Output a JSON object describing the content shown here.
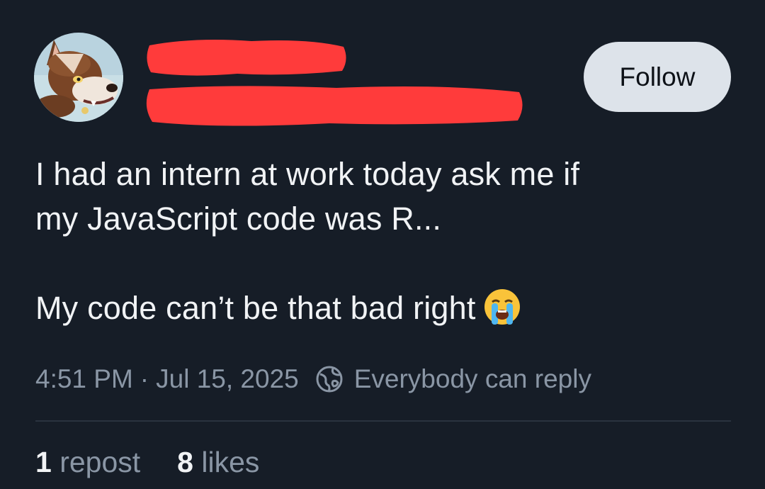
{
  "post": {
    "author_avatar_icon": "avatar-wolf-fursona",
    "redaction_color": "#ff3b3b",
    "follow_label": "Follow",
    "text_lines": [
      "I had an intern at work today ask me if",
      "my JavaScript code was R...",
      "My code can’t be that bad right"
    ],
    "emoji": "😭",
    "emoji_icon": "loudly-crying-face-icon",
    "timestamp": "4:51 PM",
    "separator": "·",
    "date": "Jul 15, 2025",
    "reply_icon": "globe-icon",
    "reply_setting": "Everybody can reply",
    "reposts_count": "1",
    "reposts_label": "repost",
    "likes_count": "8",
    "likes_label": "likes"
  },
  "colors": {
    "background": "#161d27",
    "text": "#f1f3f5",
    "muted": "#8a96a5",
    "follow_bg": "#dde3ea"
  }
}
